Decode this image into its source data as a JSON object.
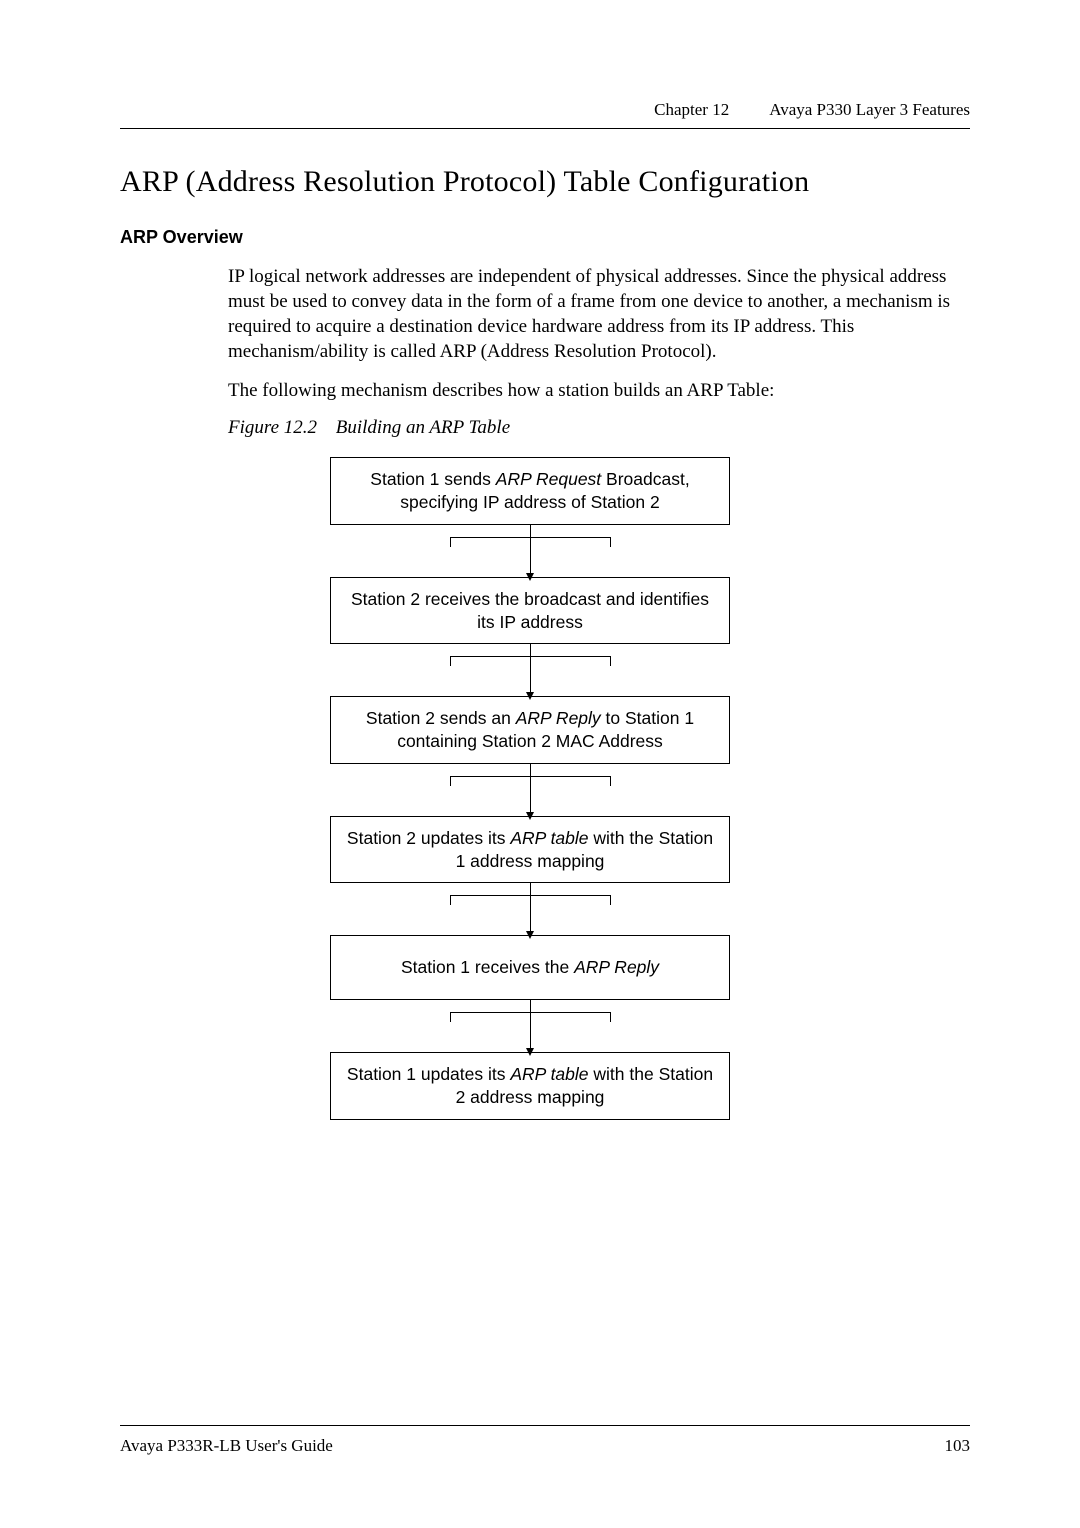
{
  "header": {
    "chapter_label": "Chapter 12",
    "chapter_title": "Avaya P330 Layer 3 Features"
  },
  "section_title": "ARP (Address Resolution Protocol) Table Configuration",
  "subhead": "ARP Overview",
  "paragraphs": {
    "p1": "IP logical network addresses are independent of physical addresses. Since the physical address must be used to convey data in the form of a frame from one device to another, a mechanism is required to acquire a destination device hardware address from its IP address. This mechanism/ability is called ARP (Address Resolution Protocol).",
    "p2": "The following mechanism describes how a station builds an ARP Table:"
  },
  "figure": {
    "number": "Figure 12.2",
    "title": "Building an ARP Table"
  },
  "chart_data": {
    "type": "flowchart",
    "direction": "top-to-bottom",
    "nodes": [
      {
        "id": "n1",
        "text_pre": "Station 1 sends ",
        "em": "ARP Request",
        "text_post": " Broadcast, specifying IP address of Station 2"
      },
      {
        "id": "n2",
        "text_pre": "Station 2 receives the broadcast and identifies its IP address",
        "em": "",
        "text_post": ""
      },
      {
        "id": "n3",
        "text_pre": "Station 2 sends an ",
        "em": "ARP Reply",
        "text_post": " to Station 1 containing Station 2 MAC Address"
      },
      {
        "id": "n4",
        "text_pre": "Station 2 updates its ",
        "em": "ARP table",
        "text_post": " with the Station 1 address mapping"
      },
      {
        "id": "n5",
        "text_pre": "Station 1 receives the ",
        "em": "ARP Reply",
        "text_post": ""
      },
      {
        "id": "n6",
        "text_pre": "Station 1 updates its ",
        "em": "ARP table",
        "text_post": " with the Station 2 address mapping"
      }
    ],
    "edges": [
      [
        "n1",
        "n2"
      ],
      [
        "n2",
        "n3"
      ],
      [
        "n3",
        "n4"
      ],
      [
        "n4",
        "n5"
      ],
      [
        "n5",
        "n6"
      ]
    ]
  },
  "footer": {
    "left": "Avaya P333R-LB User's Guide",
    "right": "103"
  }
}
